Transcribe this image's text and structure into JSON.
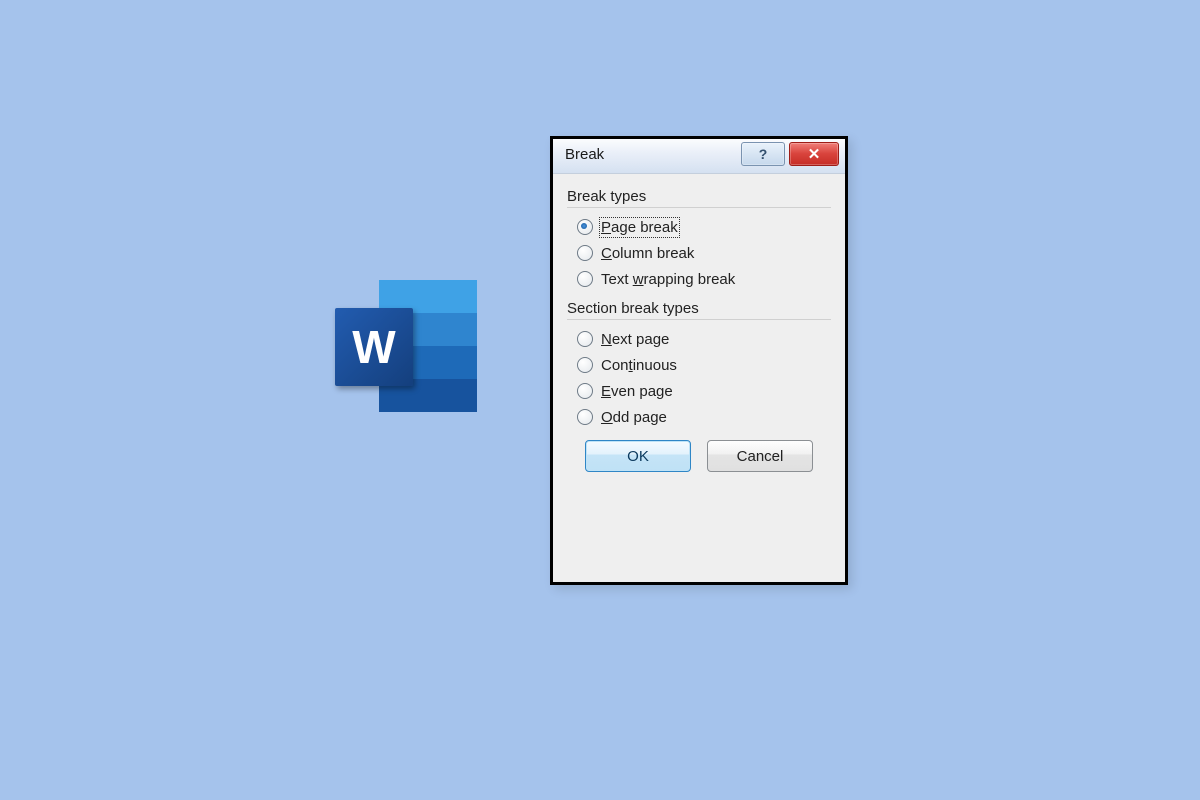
{
  "word_icon": {
    "letter": "W"
  },
  "dialog": {
    "title": "Break",
    "help_symbol": "?",
    "close_symbol": "✕",
    "groups": [
      {
        "label": "Break types",
        "options": [
          {
            "prefix": "",
            "hotkey": "P",
            "suffix": "age break",
            "checked": true,
            "focused": true
          },
          {
            "prefix": "",
            "hotkey": "C",
            "suffix": "olumn break",
            "checked": false,
            "focused": false
          },
          {
            "prefix": "Text ",
            "hotkey": "w",
            "suffix": "rapping break",
            "checked": false,
            "focused": false
          }
        ]
      },
      {
        "label": "Section break types",
        "options": [
          {
            "prefix": "",
            "hotkey": "N",
            "suffix": "ext page",
            "checked": false,
            "focused": false
          },
          {
            "prefix": "Con",
            "hotkey": "t",
            "suffix": "inuous",
            "checked": false,
            "focused": false
          },
          {
            "prefix": "",
            "hotkey": "E",
            "suffix": "ven page",
            "checked": false,
            "focused": false
          },
          {
            "prefix": "",
            "hotkey": "O",
            "suffix": "dd page",
            "checked": false,
            "focused": false
          }
        ]
      }
    ],
    "buttons": {
      "ok": "OK",
      "cancel": "Cancel"
    }
  }
}
